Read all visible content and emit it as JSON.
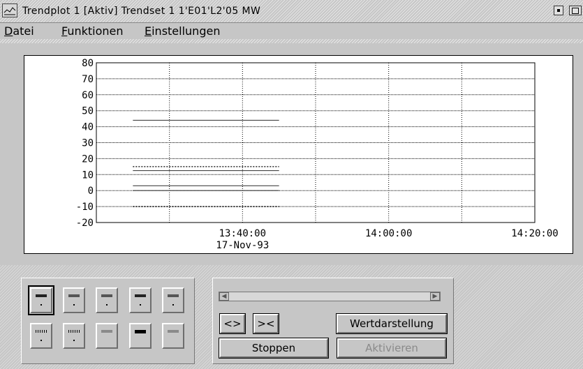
{
  "window": {
    "title": "Trendplot 1 [Aktiv] Trendset 1 1'E01'L2'05 MW"
  },
  "menu": {
    "items": [
      {
        "accel": "D",
        "rest": "atei"
      },
      {
        "accel": "F",
        "rest": "unktionen"
      },
      {
        "accel": "E",
        "rest": "instellungen"
      }
    ]
  },
  "chart_data": {
    "type": "line",
    "title": "",
    "xlabel": "",
    "ylabel": "",
    "ylim": [
      -20,
      80
    ],
    "yticks": [
      "80",
      "70",
      "60",
      "50",
      "40",
      "30",
      "20",
      "10",
      "0",
      "-10",
      "-20"
    ],
    "xtick_labels": [
      {
        "time": "13:40:00",
        "date": "17-Nov-93"
      },
      {
        "time": "14:00:00",
        "date": ""
      },
      {
        "time": "14:20:00",
        "date": ""
      }
    ],
    "grid": true,
    "series": [
      {
        "style": "solid",
        "x_start": "13:25:00",
        "x_end": "13:45:00",
        "value": 44
      },
      {
        "style": "dotted",
        "x_start": "13:25:00",
        "x_end": "13:45:00",
        "value": 15
      },
      {
        "style": "solid",
        "x_start": "13:25:00",
        "x_end": "13:45:00",
        "value": 12.5
      },
      {
        "style": "solid",
        "x_start": "13:25:00",
        "x_end": "13:45:00",
        "value": 3
      },
      {
        "style": "solid",
        "x_start": "13:25:00",
        "x_end": "13:45:00",
        "value": 0
      },
      {
        "style": "dotted",
        "x_start": "13:25:00",
        "x_end": "13:45:00",
        "value": -10
      }
    ]
  },
  "channels": [
    {
      "swatch": "solid-dark",
      "dot": true
    },
    {
      "swatch": "solid-mid",
      "dot": true
    },
    {
      "swatch": "solid-mid",
      "dot": true
    },
    {
      "swatch": "solid-dark",
      "dot": true
    },
    {
      "swatch": "solid-mid",
      "dot": true
    },
    {
      "swatch": "dotted",
      "dot": true
    },
    {
      "swatch": "dotted",
      "dot": true
    },
    {
      "swatch": "solid-light",
      "dot": false
    },
    {
      "swatch": "solid-black",
      "dot": false
    },
    {
      "swatch": "solid-light",
      "dot": false
    }
  ],
  "controls": {
    "expand_label": "<>",
    "compress_label": "><",
    "value_display_label": "Wertdarstellung",
    "stop_label": "Stoppen",
    "activate_label": "Aktivieren"
  }
}
